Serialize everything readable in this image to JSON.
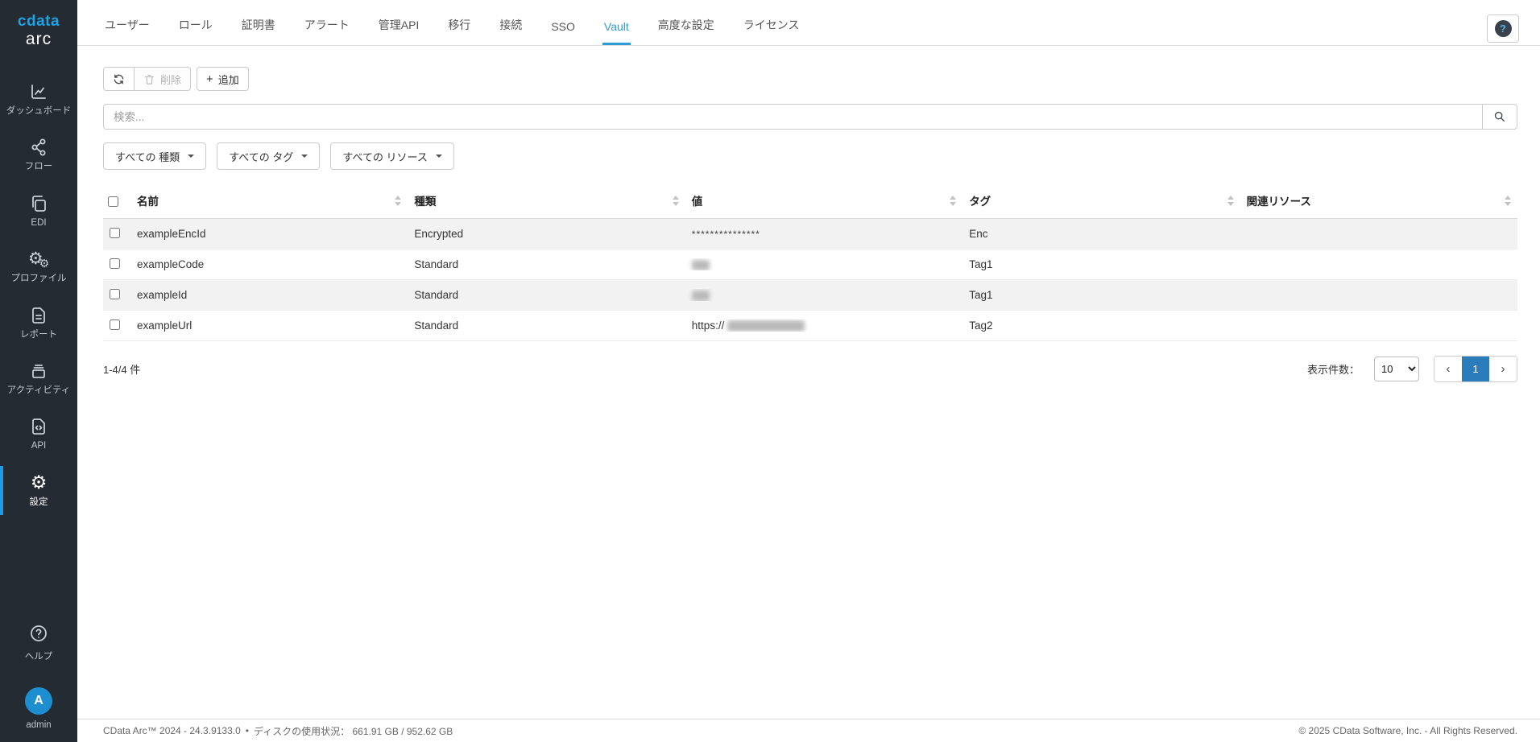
{
  "sidebar": {
    "logo": {
      "brand": "cdata",
      "product": "arc"
    },
    "items": [
      {
        "label": "ダッシュボード",
        "icon": "chart-line"
      },
      {
        "label": "フロー",
        "icon": "share-nodes"
      },
      {
        "label": "EDI",
        "icon": "copy"
      },
      {
        "label": "プロファイル",
        "icon": "double-gear"
      },
      {
        "label": "レポート",
        "icon": "file-lines"
      },
      {
        "label": "アクティビティ",
        "icon": "tray-stack"
      },
      {
        "label": "API",
        "icon": "file-code"
      },
      {
        "label": "設定",
        "icon": "gear",
        "active": true
      },
      {
        "label": "ヘルプ",
        "icon": "question-circle"
      }
    ],
    "user": {
      "initial": "A",
      "name": "admin"
    }
  },
  "icons": {
    "gear": "⚙",
    "question": "?",
    "plus": "+",
    "prev": "‹",
    "next": "›",
    "bullet": "•"
  },
  "tabs": {
    "items": [
      "ユーザー",
      "ロール",
      "証明書",
      "アラート",
      "管理API",
      "移行",
      "接続",
      "SSO",
      "Vault",
      "高度な設定",
      "ライセンス"
    ],
    "active": "Vault"
  },
  "toolbar": {
    "delete_label": "削除",
    "add_label": "追加"
  },
  "search": {
    "placeholder": "検索..."
  },
  "filters": [
    {
      "label": "すべての 種類"
    },
    {
      "label": "すべての タグ"
    },
    {
      "label": "すべての リソース"
    }
  ],
  "table": {
    "columns": [
      "名前",
      "種類",
      "値",
      "タグ",
      "関連リソース"
    ],
    "rows": [
      {
        "name": "exampleEncId",
        "type": "Encrypted",
        "value": "***************",
        "tag": "Enc",
        "related": ""
      },
      {
        "name": "exampleCode",
        "type": "Standard",
        "value_blurred": true,
        "tag": "Tag1",
        "related": ""
      },
      {
        "name": "exampleId",
        "type": "Standard",
        "value_blurred": true,
        "tag": "Tag1",
        "related": ""
      },
      {
        "name": "exampleUrl",
        "type": "Standard",
        "value_prefix": "https://",
        "value_blurred": true,
        "tag": "Tag2",
        "related": ""
      }
    ]
  },
  "pagination": {
    "range_text": "1-4/4 件",
    "page_size_label": "表示件数：",
    "page_size": "10",
    "page": "1"
  },
  "footer": {
    "version": "CData Arc™ 2024 - 24.3.9133.0",
    "disk_usage": "ディスクの使用状況： 661.91 GB / 952.62 GB",
    "copyright": "© 2025 CData Software, Inc. - All Rights Reserved."
  }
}
